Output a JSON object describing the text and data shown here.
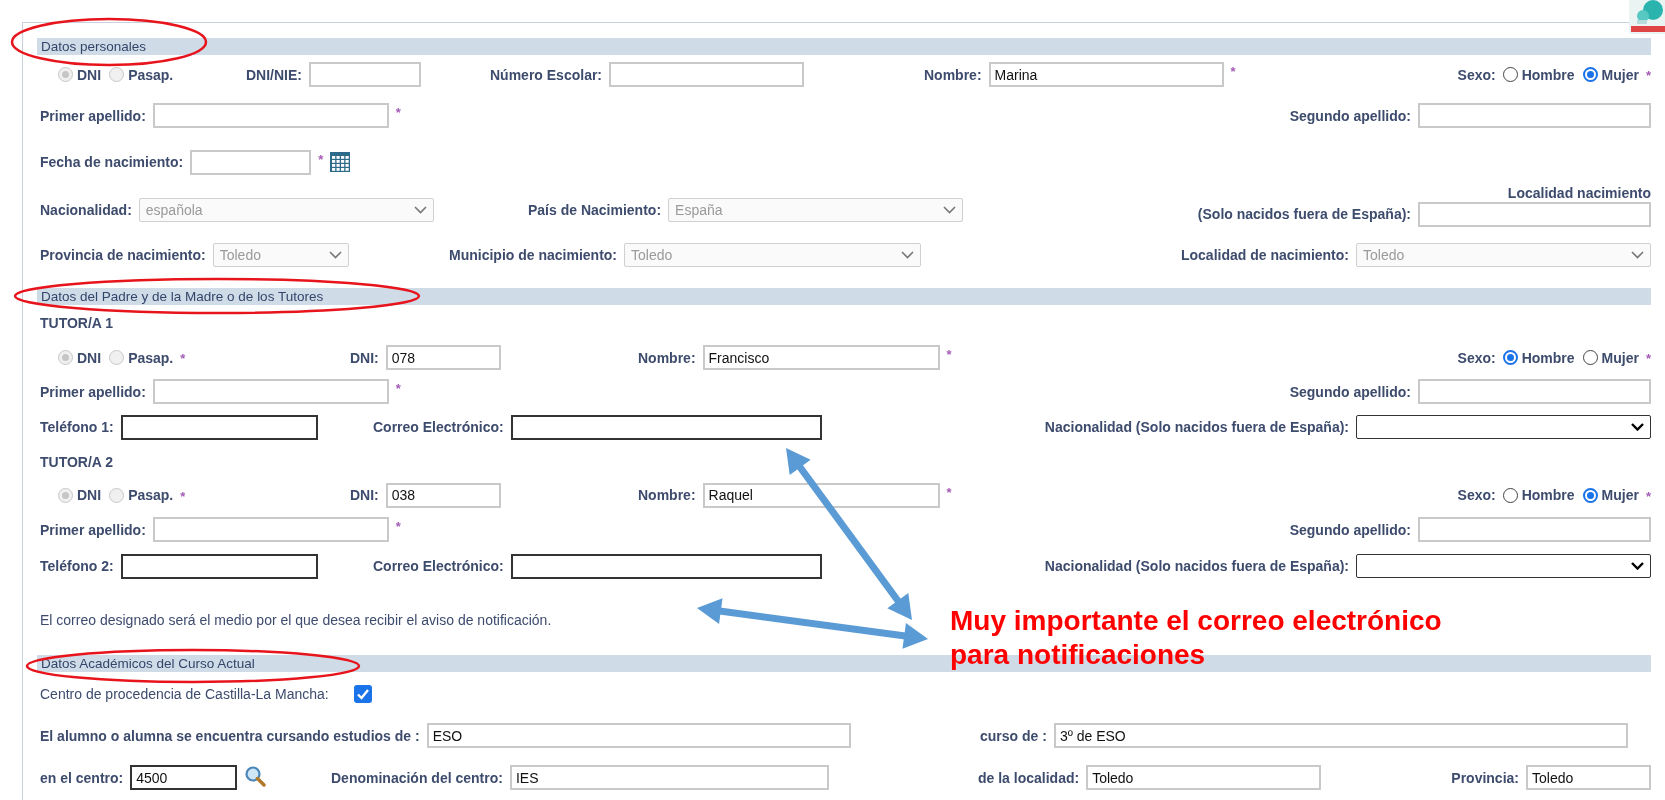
{
  "sections": [
    {
      "title": "Datos personales",
      "rows": [
        {
          "kind": "fields",
          "items": [
            {
              "kind": "doc-type",
              "disabled": true,
              "options": [
                {
                  "label": "DNI",
                  "selected": true
                },
                {
                  "label": "Pasap.",
                  "selected": false
                }
              ]
            },
            {
              "kind": "text",
              "label": "DNI/NIE:"
            },
            {
              "kind": "text",
              "label": "Número Escolar:"
            },
            {
              "kind": "text",
              "label": "Nombre:",
              "value": "Marina",
              "mark": "*"
            },
            {
              "kind": "radio",
              "label": "Sexo:",
              "options": [
                {
                  "label": "Hombre",
                  "selected": false
                },
                {
                  "label": "Mujer",
                  "selected": true
                }
              ],
              "mark": "*"
            }
          ]
        },
        {
          "kind": "fields",
          "items": [
            {
              "kind": "text",
              "label": "Primer apellido:",
              "mark": "*"
            },
            {
              "kind": "text",
              "label": "Segundo apellido:"
            }
          ]
        },
        {
          "kind": "fields",
          "items": [
            {
              "kind": "date",
              "label": "Fecha de nacimiento:",
              "mark": "*"
            }
          ]
        },
        {
          "kind": "fields",
          "items": [
            {
              "kind": "select",
              "label": "Nacionalidad:",
              "value": "española",
              "disabled": true
            },
            {
              "kind": "select",
              "label": "País de Nacimiento:",
              "value": "España",
              "disabled": true
            },
            {
              "kind": "stacked",
              "label_lines": [
                "Localidad nacimiento",
                "(Solo nacidos fuera de España):"
              ]
            }
          ]
        },
        {
          "kind": "fields",
          "items": [
            {
              "kind": "select",
              "label": "Provincia de nacimiento:",
              "value": "Toledo",
              "disabled": true
            },
            {
              "kind": "select",
              "label": "Municipio de nacimiento:",
              "value": "Toledo",
              "disabled": true
            },
            {
              "kind": "select",
              "label": "Localidad de nacimiento:",
              "value": "Toledo",
              "disabled": true
            }
          ]
        }
      ]
    },
    {
      "title": "Datos del Padre y de la Madre o de los Tutores",
      "rows": [
        {
          "kind": "heading",
          "text": "TUTOR/A 1"
        },
        {
          "kind": "fields",
          "items": [
            {
              "kind": "doc-type",
              "disabled": true,
              "mark": "*",
              "options": [
                {
                  "label": "DNI",
                  "selected": true
                },
                {
                  "label": "Pasap.",
                  "selected": false
                }
              ]
            },
            {
              "kind": "text",
              "label": "DNI:",
              "value": "078"
            },
            {
              "kind": "text",
              "label": "Nombre:",
              "value": "Francisco",
              "mark": "*"
            },
            {
              "kind": "radio",
              "label": "Sexo:",
              "options": [
                {
                  "label": "Hombre",
                  "selected": true
                },
                {
                  "label": "Mujer",
                  "selected": false
                }
              ],
              "mark": "*"
            }
          ]
        },
        {
          "kind": "fields",
          "items": [
            {
              "kind": "text",
              "label": "Primer apellido:",
              "mark": "*"
            },
            {
              "kind": "text",
              "label": "Segundo apellido:"
            }
          ]
        },
        {
          "kind": "fields",
          "items": [
            {
              "kind": "text",
              "label": "Teléfono 1:"
            },
            {
              "kind": "text",
              "label": "Correo Electrónico:"
            },
            {
              "kind": "select",
              "label": "Nacionalidad (Solo nacidos fuera de España):",
              "disabled": false
            }
          ]
        },
        {
          "kind": "heading",
          "text": "TUTOR/A 2"
        },
        {
          "kind": "fields",
          "items": [
            {
              "kind": "doc-type",
              "disabled": true,
              "mark": "*",
              "options": [
                {
                  "label": "DNI",
                  "selected": true
                },
                {
                  "label": "Pasap.",
                  "selected": false
                }
              ]
            },
            {
              "kind": "text",
              "label": "DNI:",
              "value": "038"
            },
            {
              "kind": "text",
              "label": "Nombre:",
              "value": "Raquel",
              "mark": "*"
            },
            {
              "kind": "radio",
              "label": "Sexo:",
              "options": [
                {
                  "label": "Hombre",
                  "selected": false
                },
                {
                  "label": "Mujer",
                  "selected": true
                }
              ],
              "mark": "*"
            }
          ]
        },
        {
          "kind": "fields",
          "items": [
            {
              "kind": "text",
              "label": "Primer apellido:",
              "mark": "*"
            },
            {
              "kind": "text",
              "label": "Segundo apellido:"
            }
          ]
        },
        {
          "kind": "fields",
          "items": [
            {
              "kind": "text",
              "label": "Teléfono 2:"
            },
            {
              "kind": "text",
              "label": "Correo Electrónico:"
            },
            {
              "kind": "select",
              "label": "Nacionalidad (Solo nacidos fuera de España):",
              "disabled": false
            }
          ]
        },
        {
          "kind": "note",
          "text": "El correo designado será el medio por el que desea recibir el aviso de notificación."
        }
      ]
    },
    {
      "title": "Datos Académicos del Curso Actual",
      "rows": [
        {
          "kind": "fields",
          "items": [
            {
              "kind": "checkbox",
              "label": "Centro de procedencia de Castilla-La Mancha:",
              "checked": true
            }
          ]
        },
        {
          "kind": "fields",
          "items": [
            {
              "kind": "text",
              "label": "El alumno o alumna se encuentra cursando estudios de :",
              "value": "ESO"
            },
            {
              "kind": "text",
              "label": "curso de :",
              "value": "3º de ESO"
            }
          ]
        },
        {
          "kind": "fields",
          "items": [
            {
              "kind": "code-search",
              "label": "en el centro:",
              "value": "4500"
            },
            {
              "kind": "text",
              "label": "Denominación del centro:",
              "value": "IES"
            },
            {
              "kind": "text",
              "label": "de la localidad:",
              "value": "Toledo"
            },
            {
              "kind": "text",
              "label": "Provincia:",
              "value": "Toledo"
            }
          ]
        }
      ]
    }
  ],
  "annotation": {
    "text_lines": [
      "Muy importante el correo electrónico",
      "para notificaciones"
    ]
  }
}
